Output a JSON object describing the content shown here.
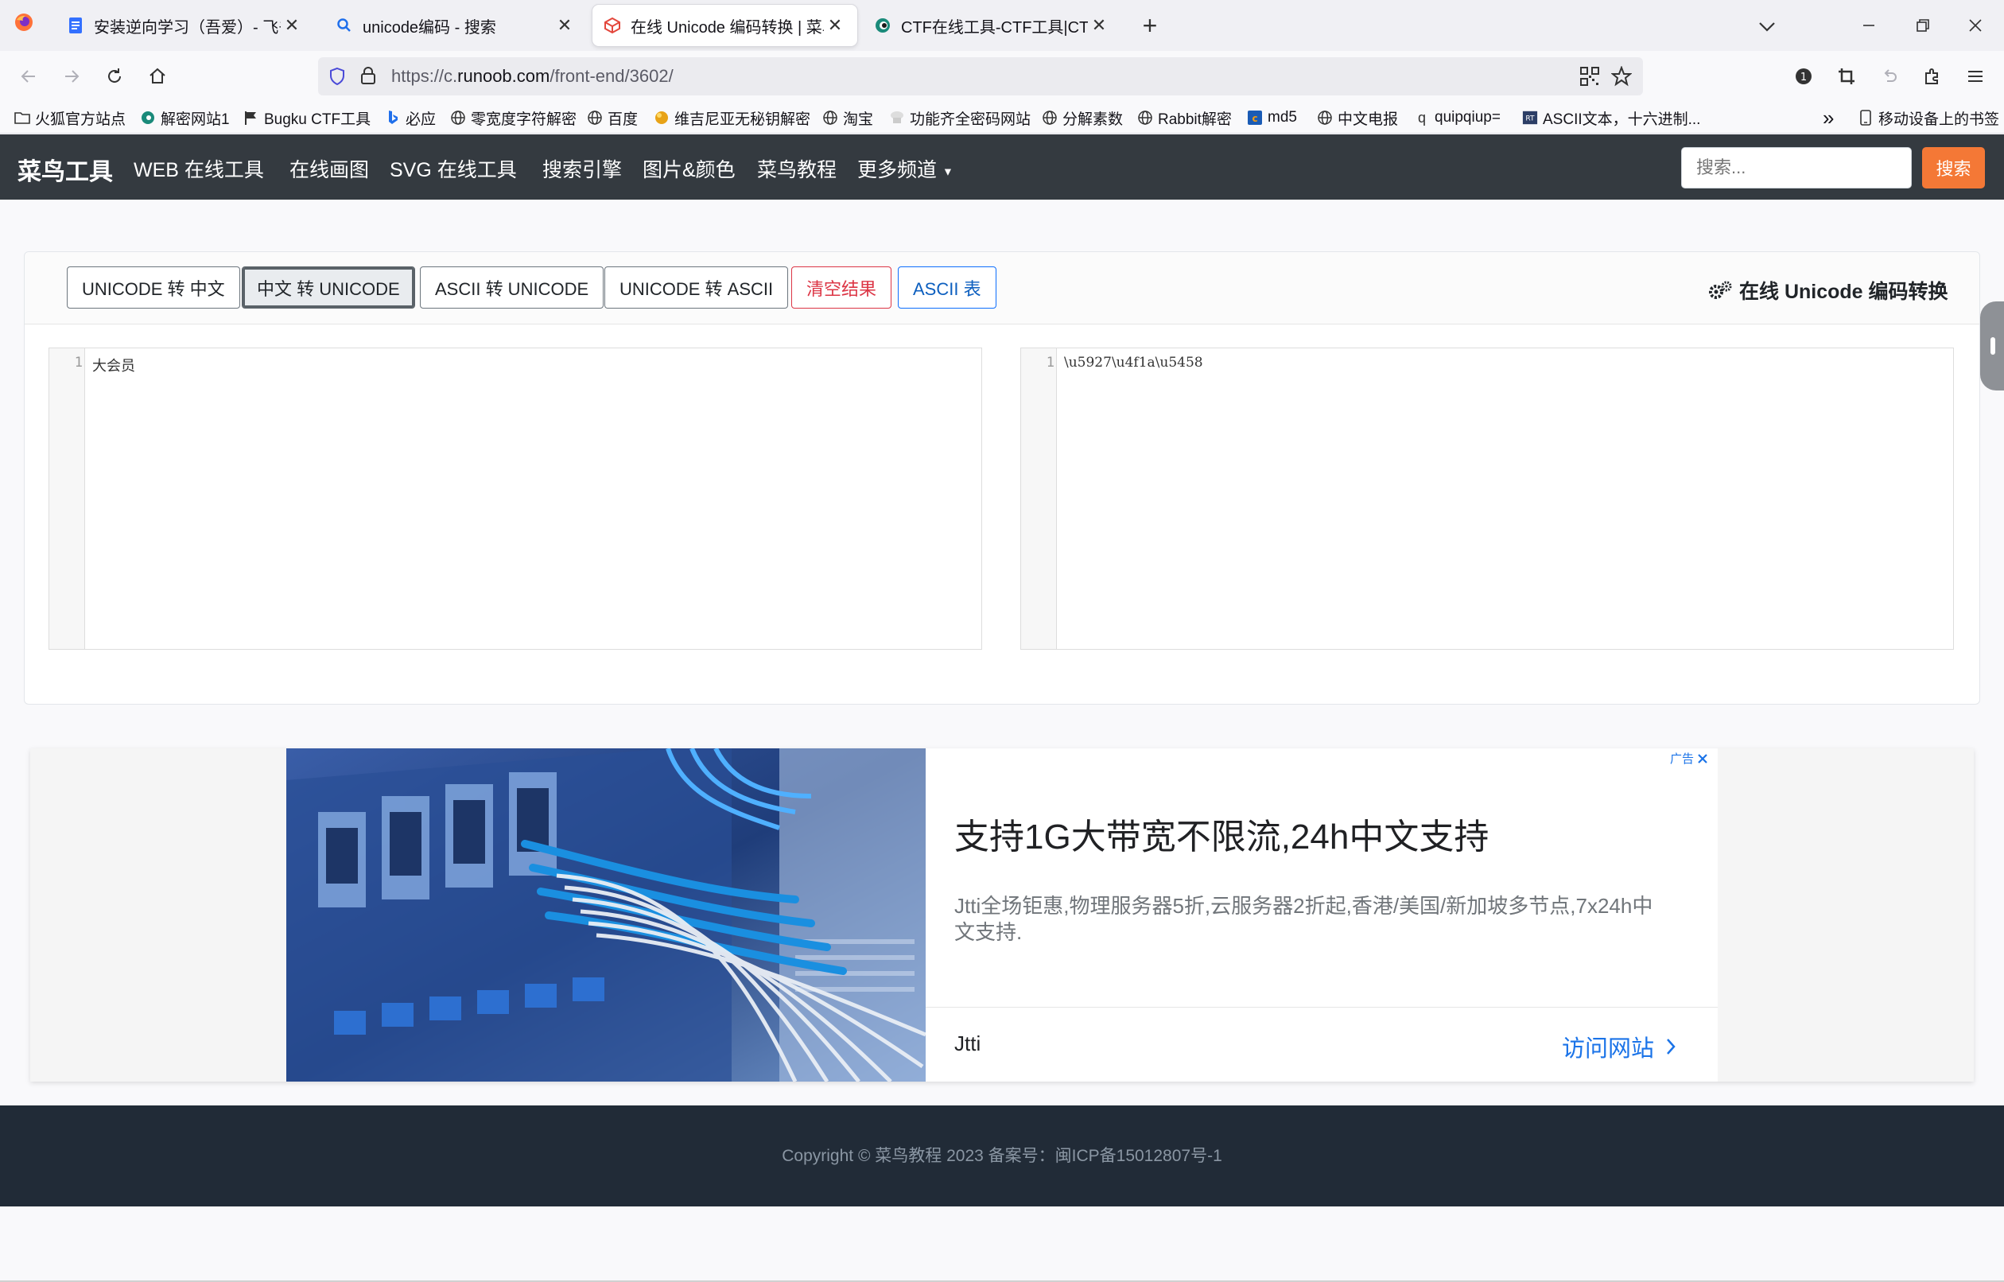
{
  "browser": {
    "tabs": [
      {
        "title": "安装逆向学习（吾爱）- 飞书云文档",
        "icon": "doc-icon"
      },
      {
        "title": "unicode编码 - 搜索",
        "icon": "search-icon"
      },
      {
        "title": "在线 Unicode 编码转换 | 菜鸟工具",
        "icon": "runoob-icon"
      },
      {
        "title": "CTF在线工具-CTF工具|CTF编码",
        "icon": "ctf-icon"
      }
    ],
    "new_tab": "+",
    "url_prefix": "https://c.",
    "url_domain": "runoob.com",
    "url_path": "/front-end/3602/",
    "bookmarks": [
      {
        "label": "火狐官方站点",
        "icon": "folder-icon"
      },
      {
        "label": "解密网站1",
        "icon": "ctf-icon"
      },
      {
        "label": "Bugku CTF工具",
        "icon": "flag-icon"
      },
      {
        "label": "必应",
        "icon": "bing-icon"
      },
      {
        "label": "零宽度字符解密",
        "icon": "globe-icon"
      },
      {
        "label": "百度",
        "icon": "globe-icon"
      },
      {
        "label": "维吉尼亚无秘钥解密",
        "icon": "orb-icon"
      },
      {
        "label": "淘宝",
        "icon": "globe-icon"
      },
      {
        "label": "功能齐全密码网站",
        "icon": "chef-icon"
      },
      {
        "label": "分解素数",
        "icon": "globe-icon"
      },
      {
        "label": "Rabbit解密",
        "icon": "globe-icon"
      },
      {
        "label": "md5",
        "icon": "cmd5-icon"
      },
      {
        "label": "中文电报",
        "icon": "globe-icon"
      },
      {
        "label": "quipqiup=",
        "icon": "q-icon"
      },
      {
        "label": "ASCII文本，十六进制...",
        "icon": "rt-icon"
      }
    ],
    "more_bookmarks": "»",
    "mobile_bookmarks": "移动设备上的书签"
  },
  "site": {
    "brand": "菜鸟工具",
    "nav": [
      "WEB 在线工具",
      "在线画图",
      "SVG 在线工具",
      "搜索引擎",
      "图片&颜色",
      "菜鸟教程",
      "更多频道"
    ],
    "search_placeholder": "搜索...",
    "search_button": "搜索"
  },
  "tool": {
    "buttons": [
      "UNICODE 转 中文",
      "中文 转 UNICODE",
      "ASCII 转 UNICODE",
      "UNICODE 转 ASCII",
      "清空结果",
      "ASCII 表"
    ],
    "active_button": "中文 转 UNICODE",
    "title": "在线 Unicode 编码转换",
    "input": {
      "line_number": "1",
      "text": "大会员"
    },
    "output": {
      "line_number": "1",
      "text": "\\u5927\\u4f1a\\u5458"
    }
  },
  "ad": {
    "label": "广告",
    "headline": "支持1G大带宽不限流,24h中文支持",
    "description": "Jtti全场钜惠,物理服务器5折,云服务器2折起,香港/美国/新加坡多节点,7x24h中文支持.",
    "advertiser": "Jtti",
    "cta": "访问网站"
  },
  "footer": {
    "text": "Copyright © 菜鸟教程 2023 备案号：闽ICP备15012807号-1"
  },
  "colors": {
    "header_bg": "#343a40",
    "accent": "#f47836",
    "footer_bg": "#212b37",
    "link_blue": "#1a73e8"
  }
}
